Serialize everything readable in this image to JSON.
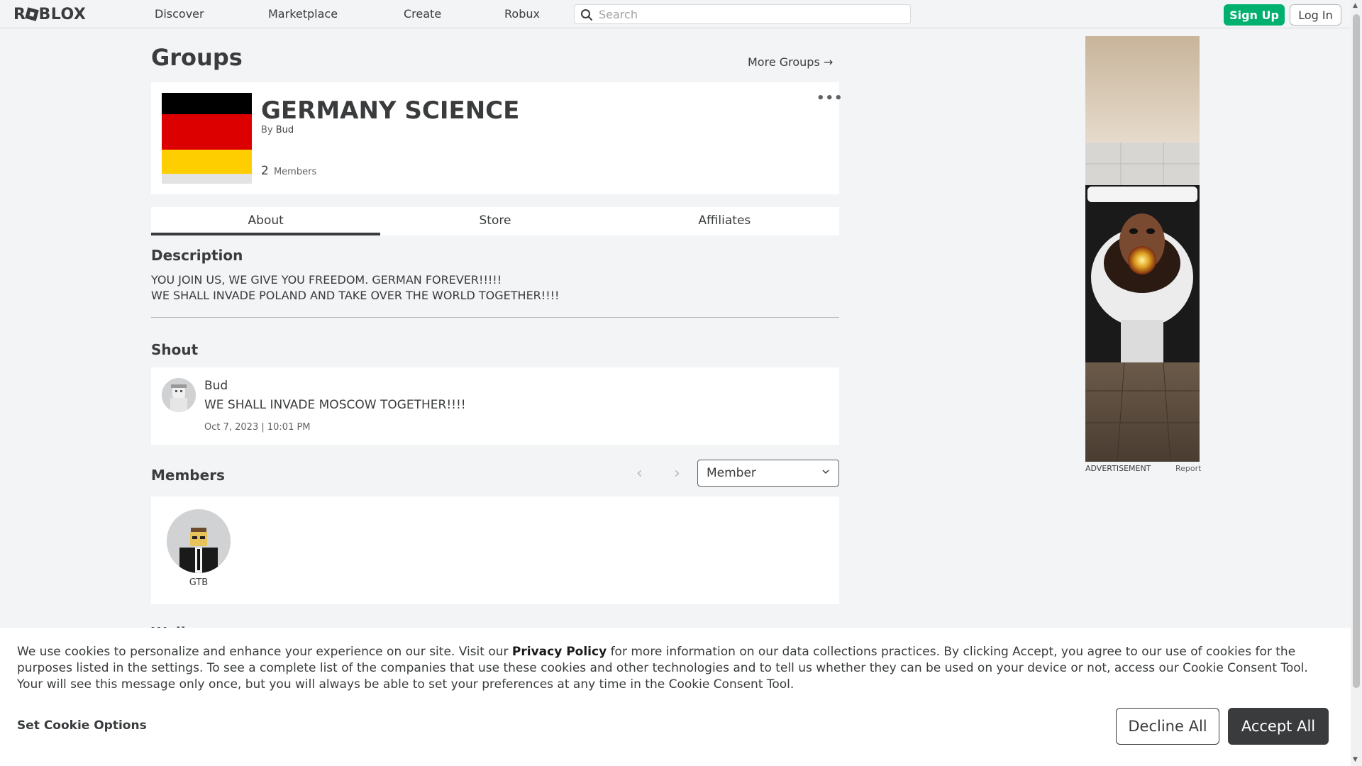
{
  "nav": {
    "logo": "ROBLOX",
    "links": [
      "Discover",
      "Marketplace",
      "Create",
      "Robux"
    ],
    "search_placeholder": "Search",
    "signup_label": "Sign Up",
    "login_label": "Log In"
  },
  "page": {
    "title": "Groups",
    "more_groups": "More Groups →"
  },
  "group": {
    "name": "GERMANY SCIENCE",
    "by_label": "By",
    "owner": "Bud",
    "member_count": "2",
    "members_label": "Members",
    "more_menu": "•••"
  },
  "tabs": [
    "About",
    "Store",
    "Affiliates"
  ],
  "about": {
    "description_heading": "Description",
    "description_lines": [
      "YOU JOIN US, WE GIVE YOU FREEDOM. GERMAN FOREVER!!!!!",
      "WE SHALL INVADE POLAND AND TAKE OVER THE WORLD TOGETHER!!!!"
    ],
    "shout_heading": "Shout",
    "shout": {
      "author": "Bud",
      "text": "WE SHALL INVADE MOSCOW TOGETHER!!!!",
      "date": "Oct 7, 2023 | 10:01 PM"
    },
    "members_heading": "Members",
    "role_selected": "Member",
    "members": [
      {
        "name": "GTB"
      }
    ],
    "next_heading_partial": "Wall"
  },
  "ad": {
    "label": "ADVERTISEMENT",
    "report": "Report"
  },
  "cookie": {
    "text_before": "We use cookies to personalize and enhance your experience on our site. Visit our ",
    "policy_link": "Privacy Policy",
    "text_after": " for more information on our data collections practices. By clicking Accept, you agree to our use of cookies for the purposes listed in the settings. To see a complete list of the companies that use these cookies and other technologies and to tell us whether they can be used on your device or not, access our Cookie Consent Tool. Your will see this message only once, but you will always be able to set your preferences at any time in the Cookie Consent Tool.",
    "set_options": "Set Cookie Options",
    "decline": "Decline All",
    "accept": "Accept All"
  },
  "colors": {
    "accent_green": "#00b06f",
    "text_dark": "#393b3d",
    "background": "#f2f4f5",
    "flag_black": "#000000",
    "flag_red": "#dd0000",
    "flag_gold": "#ffce00"
  }
}
